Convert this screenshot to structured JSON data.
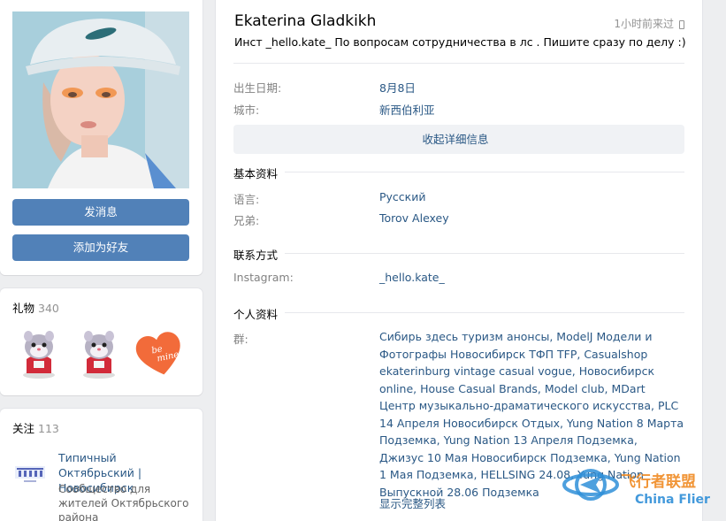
{
  "profile": {
    "name": "Ekaterina Gladkikh",
    "last_seen": "1小时前来过",
    "status": "Инст _hello.kate_ По вопросам сотрудничества в лс . Пишите сразу по делу :)"
  },
  "actions": {
    "message_label": "发消息",
    "add_friend_label": "添加为好友"
  },
  "gifts": {
    "title": "礼物",
    "count": "340"
  },
  "following": {
    "title": "关注",
    "count": "113",
    "community": {
      "name": "Типичный Октябрьский | Новосибирск",
      "description": "Сообщество для жителей Октябрьского района"
    }
  },
  "info": {
    "birthday_label": "出生日期:",
    "birthday_value": "8月8日",
    "city_label": "城市:",
    "city_value": "新西伯利亚",
    "collapse_label": "收起详细信息"
  },
  "basic": {
    "title": "基本资料",
    "language_label": "语言:",
    "language_value": "Русский",
    "brother_label": "兄弟:",
    "brother_value": "Torov Alexey"
  },
  "contacts": {
    "title": "联系方式",
    "instagram_label": "Instagram:",
    "instagram_value": "_hello.kate_"
  },
  "personal": {
    "title": "个人资料",
    "groups_label": "群:",
    "groups_value": "Сибирь здесь туризм анонсы, ModelJ Модели и Фотографы Новосибирск ТФП TFP, Casualshop ekaterinburg vintage casual vogue, Новосибирск online, House Casual Brands, Model club, MDart Центр музыкально-драматического искусства, PLC 14 Апреля Новосибирск Отдых, Yung Nation 8 Марта Подземка, Yung Nation 13 Апреля Подземка, Джизус 10 Мая Новосибирск Подземка, Yung Nation 1 Мая Подземка, HELLSING 24.08, Yung Nation Выпускной 28.06 Подземка",
    "show_all_label": "显示完整列表"
  },
  "watermark": {
    "cn": "飞行者联盟",
    "en": "China Flier"
  },
  "colors": {
    "accent": "#5181b8",
    "link": "#2a5885",
    "muted": "#828282",
    "background": "#edeef0"
  }
}
